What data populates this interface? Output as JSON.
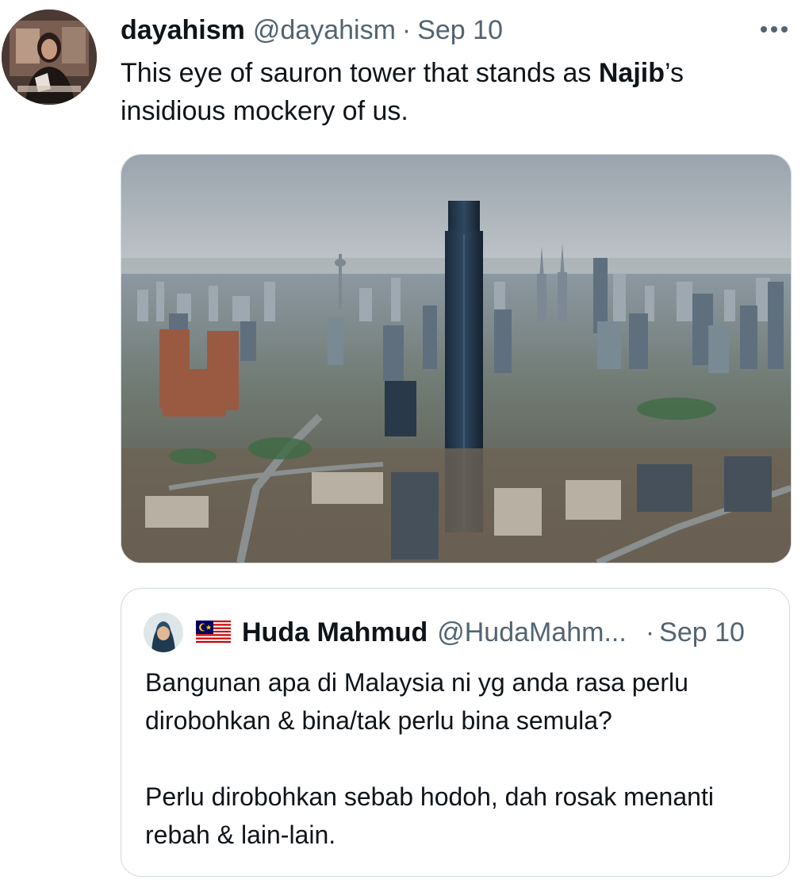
{
  "tweet": {
    "display_name": "dayahism",
    "handle": "@dayahism",
    "separator": "·",
    "time": "Sep 10",
    "text_before": "This eye of sauron tower that stands as ",
    "text_bold": "Najib",
    "text_after": "’s insidious mockery of us.",
    "more_icon": "more-horizontal-icon",
    "media_alt": "aerial photo of city skyline with tall dark tower"
  },
  "quoted": {
    "flag_icon": "malaysia-flag-icon",
    "display_name": "Huda Mahmud",
    "handle": "@HudaMahm...",
    "separator": "·",
    "time": "Sep 10",
    "paragraph1": "Bangunan apa di Malaysia ni yg anda rasa perlu dirobohkan & bina/tak perlu bina semula?",
    "paragraph2": "Perlu dirobohkan sebab hodoh, dah rosak menanti rebah & lain-lain."
  },
  "colors": {
    "text_primary": "#0f1419",
    "text_secondary": "#536471",
    "border": "#cfd9de"
  }
}
